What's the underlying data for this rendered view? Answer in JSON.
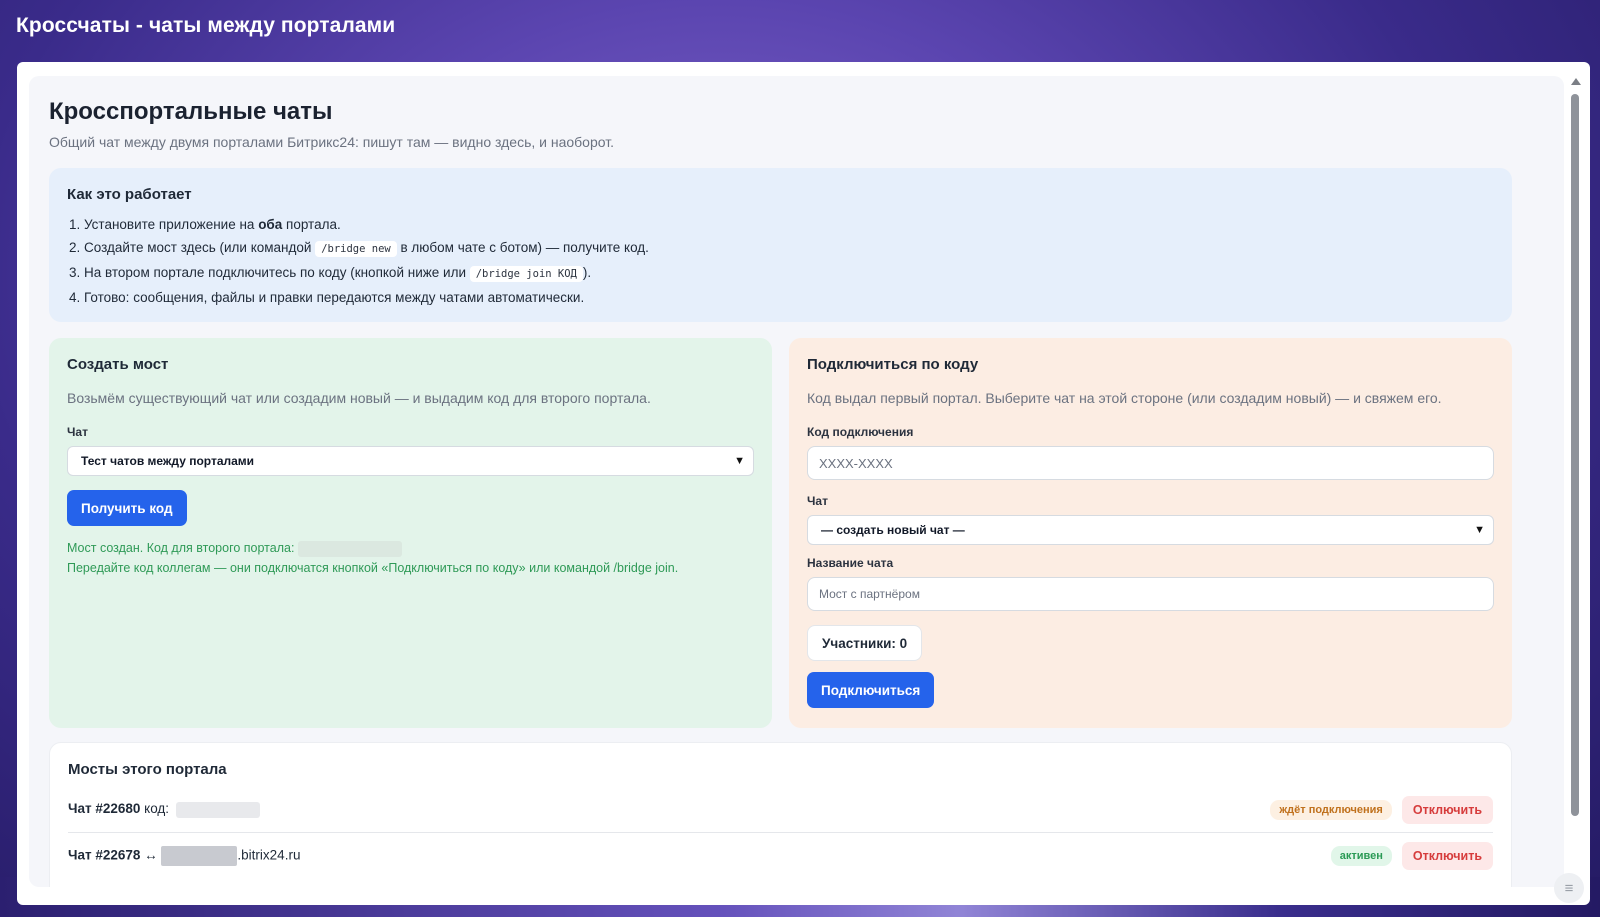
{
  "window": {
    "title": "Кроссчаты - чаты между порталами"
  },
  "page": {
    "title": "Кросспортальные чаты",
    "subtitle": "Общий чат между двумя порталами Битрикс24: пишут там — видно здесь, и наоборот."
  },
  "howto": {
    "title": "Как это работает",
    "step1_pre": "Установите приложение на ",
    "step1_bold": "оба",
    "step1_post": " портала.",
    "step2_pre": "Создайте мост здесь (или командой ",
    "step2_code": "/bridge new",
    "step2_post": " в любом чате с ботом) — получите код.",
    "step3_pre": "На втором портале подключитесь по коду (кнопкой ниже или ",
    "step3_code": "/bridge join КОД",
    "step3_post": ").",
    "step4": "Готово: сообщения, файлы и правки передаются между чатами автоматически."
  },
  "create": {
    "title": "Создать мост",
    "description": "Возьмём существующий чат или создадим новый — и выдадим код для второго портала.",
    "chat_label": "Чат",
    "chat_selected": "Тест чатов между порталами",
    "button_label": "Получить код",
    "success_line1": "Мост создан. Код для второго портала:",
    "success_line2": "Передайте код коллегам — они подключатся кнопкой «Подключиться по коду» или командой /bridge join."
  },
  "join": {
    "title": "Подключиться по коду",
    "description": "Код выдал первый портал. Выберите чат на этой стороне (или создадим новый) — и свяжем его.",
    "code_label": "Код подключения",
    "code_placeholder": "XXXX-XXXX",
    "chat_label": "Чат",
    "chat_selected": "— создать новый чат —",
    "name_label": "Название чата",
    "name_placeholder": "Мост с партнёром",
    "participants": "Участники: 0",
    "button_label": "Подключиться"
  },
  "bridges": {
    "title": "Мосты этого портала",
    "rows": [
      {
        "chat": "Чат #22680",
        "suffix": " код:",
        "status": "ждёт подключения",
        "action": "Отключить"
      },
      {
        "chat": "Чат #22678",
        "suffix": " ↔ ",
        "domain": ".bitrix24.ru",
        "status": "активен",
        "action": "Отключить"
      }
    ]
  },
  "colors": {
    "accent": "#2563eb",
    "howto_bg": "#e6effb",
    "create_bg": "#e3f4ea",
    "join_bg": "#fcede3",
    "success_text": "#2f9a57",
    "danger_text": "#d63c3c"
  },
  "icons": {
    "scroll_up": "triangle-up",
    "corner": "menu-lines-icon",
    "select_chevron": "chevron-down-icon"
  }
}
